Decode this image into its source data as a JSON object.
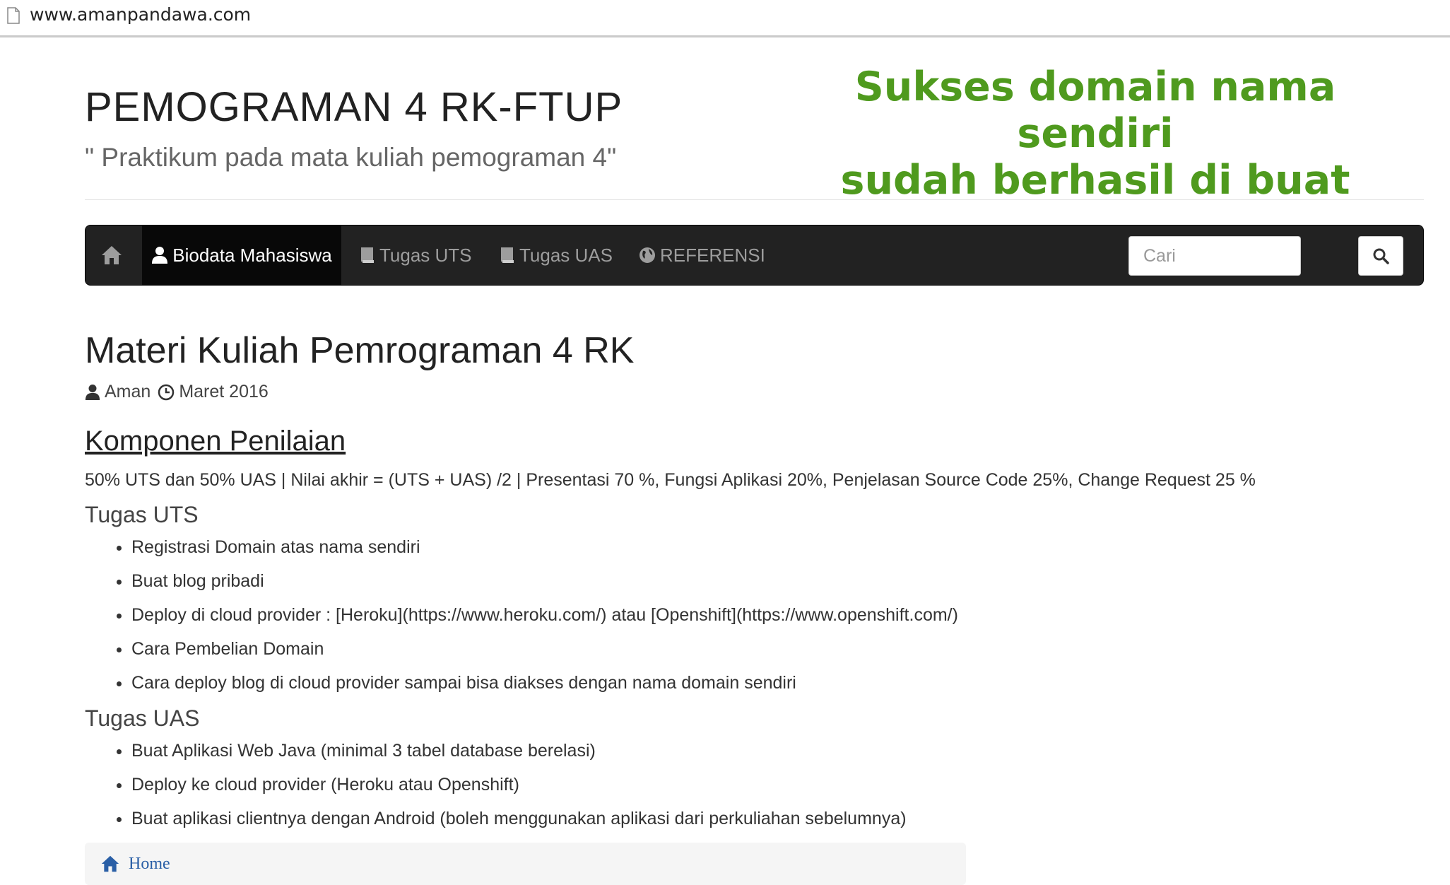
{
  "browser": {
    "url": "www.amanpandawa.com"
  },
  "header": {
    "title": "PEMOGRAMAN 4 RK-FTUP",
    "subtitle": "\" Praktikum pada mata kuliah pemograman 4\"",
    "overlay_line1": "Sukses domain nama sendiri",
    "overlay_line2": "sudah berhasil di buat"
  },
  "navbar": {
    "items": [
      {
        "label": "Biodata Mahasiswa",
        "icon": "user-icon",
        "active": true
      },
      {
        "label": "Tugas UTS",
        "icon": "book-icon",
        "active": false
      },
      {
        "label": "Tugas UAS",
        "icon": "book-icon",
        "active": false
      },
      {
        "label": "REFERENSI",
        "icon": "globe-icon",
        "active": false
      }
    ],
    "search_placeholder": "Cari"
  },
  "post": {
    "title": "Materi Kuliah Pemrograman 4 RK",
    "author": "Aman",
    "date": "Maret 2016",
    "section_title": "Komponen Penilaian",
    "grading": "50% UTS dan 50% UAS | Nilai akhir = (UTS + UAS) /2 | Presentasi 70 %, Fungsi Aplikasi 20%, Penjelasan Source Code 25%, Change Request 25 %",
    "uts": {
      "heading": "Tugas UTS",
      "items": [
        "Registrasi Domain atas nama sendiri",
        "Buat blog pribadi",
        "Deploy di cloud provider : [Heroku](https://www.heroku.com/) atau [Openshift](https://www.openshift.com/)",
        "Cara Pembelian Domain",
        "Cara deploy blog di cloud provider sampai bisa diakses dengan nama domain sendiri"
      ]
    },
    "uas": {
      "heading": "Tugas UAS",
      "items": [
        "Buat Aplikasi Web Java (minimal 3 tabel database berelasi)",
        "Deploy ke cloud provider (Heroku atau Openshift)",
        "Buat aplikasi clientnya dengan Android (boleh menggunakan aplikasi dari perkuliahan sebelumnya)"
      ]
    }
  },
  "breadcrumb": {
    "home_label": "Home"
  },
  "colors": {
    "navbar_bg": "#222222",
    "navbar_active": "#080808",
    "overlay_green": "#4f9a1e",
    "link_blue": "#2a5fa6"
  }
}
